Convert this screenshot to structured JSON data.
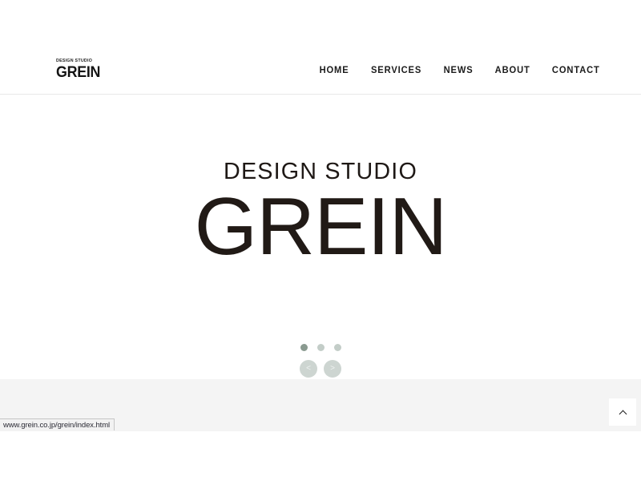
{
  "browser": {
    "status_bar": {
      "url": "www.grein.co.jp/grein/index.html"
    }
  },
  "header": {
    "logo": {
      "kicker": "DESIGN STUDIO",
      "word": "GREIN"
    },
    "nav": [
      {
        "label": "HOME"
      },
      {
        "label": "SERVICES"
      },
      {
        "label": "NEWS"
      },
      {
        "label": "ABOUT"
      },
      {
        "label": "CONTACT"
      }
    ]
  },
  "hero": {
    "kicker": "DESIGN STUDIO",
    "word": "GREIN",
    "carousel": {
      "dots": [
        {
          "active": true
        },
        {
          "active": false
        },
        {
          "active": false
        }
      ],
      "prev_label": "<",
      "next_label": ">",
      "active_dot_color": "#8a9a90",
      "inactive_dot_color": "#c3cdc8",
      "arrow_bg_color": "#cdd5d1"
    }
  },
  "footer": {
    "scroll_top_icon": "chevron-up-icon",
    "band_color": "#f4f4f4"
  },
  "theme": {
    "page_bg": "#ffffff",
    "text_color": "#1b1b1b",
    "wordmark_color": "#211a16"
  }
}
